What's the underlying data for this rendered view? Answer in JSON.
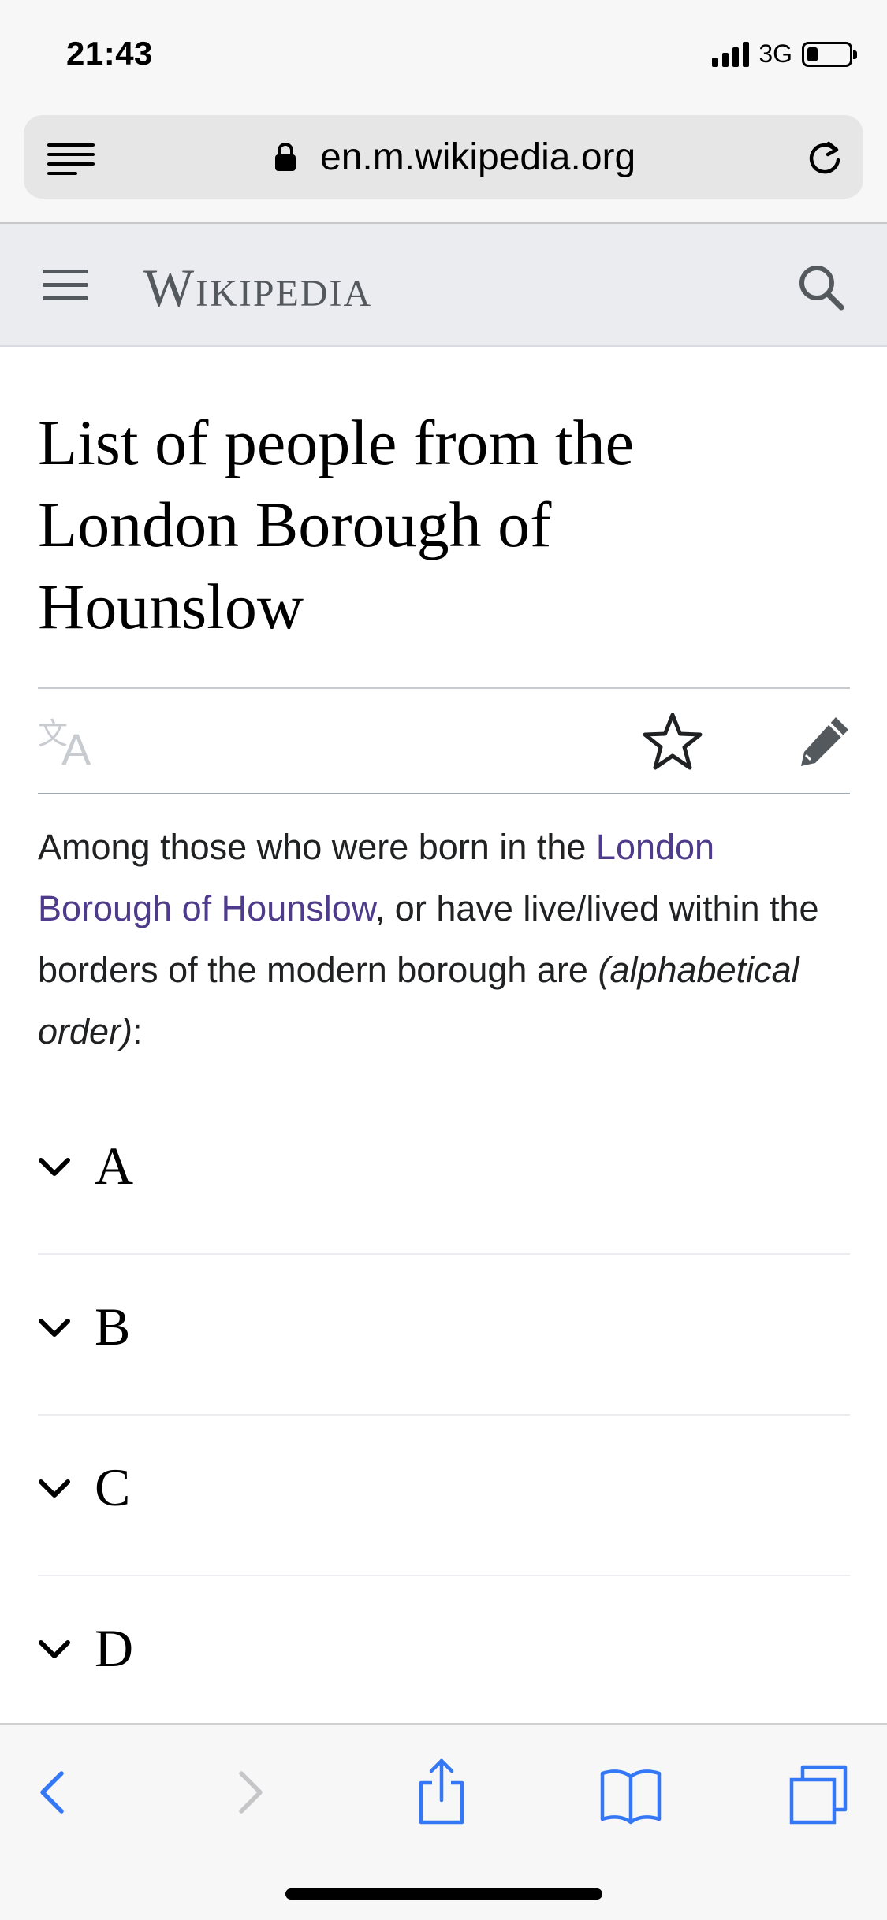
{
  "status_bar": {
    "time": "21:43",
    "network": "3G",
    "battery_level": 0.25
  },
  "browser": {
    "url": "en.m.wikipedia.org",
    "icons": [
      "reader-view-icon",
      "lock-icon",
      "reload-icon"
    ]
  },
  "header": {
    "wordmark": "Wikipedia",
    "icons": [
      "menu-icon",
      "search-icon"
    ]
  },
  "article": {
    "title": "List of people from the London Borough of Hounslow",
    "actions": [
      "language-icon",
      "watch-star-icon",
      "edit-pencil-icon"
    ],
    "intro": {
      "before_link": "Among those who were born in the ",
      "link_text": "London Borough of Hounslow",
      "after_link": ", or have live/lived within the borders of the modern borough are ",
      "italic": "(alphabetical order)",
      "end": ":"
    },
    "sections": [
      {
        "label": "A"
      },
      {
        "label": "B"
      },
      {
        "label": "C"
      },
      {
        "label": "D"
      }
    ]
  },
  "toolbar": {
    "icons": [
      "back-icon",
      "forward-icon",
      "share-icon",
      "bookmarks-icon",
      "tabs-icon"
    ]
  },
  "colors": {
    "link": "#4f3b8c",
    "ios_blue": "#3478f6",
    "header_bg": "#eaecf0",
    "icon_gray": "#54595d"
  }
}
